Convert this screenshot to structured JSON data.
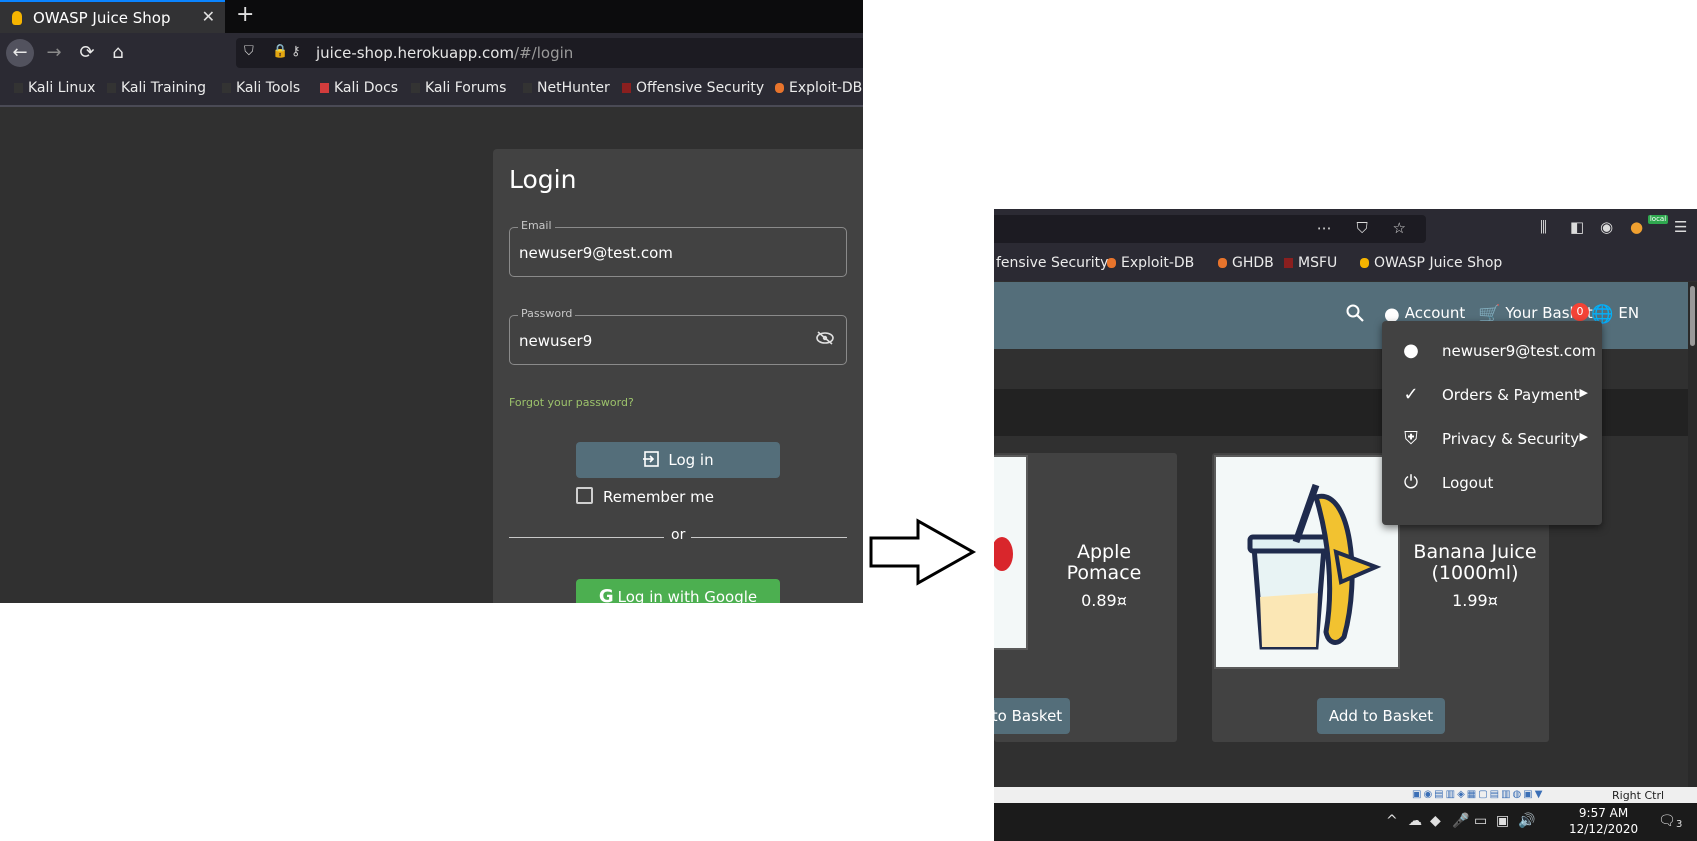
{
  "left": {
    "tab": {
      "title": "OWASP Juice Shop",
      "close": "✕",
      "new_tab": "+"
    },
    "nav": {
      "back": "←",
      "forward": "→",
      "reload": "⟳",
      "home": "⌂"
    },
    "url": {
      "host": "juice-shop.herokuapp.com",
      "path": "/#/login"
    },
    "bookmarks": [
      "Kali Linux",
      "Kali Training",
      "Kali Tools",
      "Kali Docs",
      "Kali Forums",
      "NetHunter",
      "Offensive Security",
      "Exploit-DB"
    ],
    "login": {
      "title": "Login",
      "email_label": "Email",
      "email_value": "newuser9@test.com",
      "password_label": "Password",
      "password_value": "newuser9",
      "forgot": "Forgot your password?",
      "login_button": "Log in",
      "remember": "Remember me",
      "or": "or",
      "google_button": "Log in with Google"
    }
  },
  "right": {
    "bookmarks": [
      "fensive Security",
      "Exploit-DB",
      "GHDB",
      "MSFU",
      "OWASP Juice Shop"
    ],
    "local_badge": "local",
    "header": {
      "account": "Account",
      "basket": "Your Basket",
      "basket_count": "0",
      "language": "EN"
    },
    "menu": [
      {
        "label": "newuser9@test.com",
        "icon": "account-circle-icon",
        "arrow": ""
      },
      {
        "label": "Orders & Payment",
        "icon": "check-circle-icon",
        "arrow": "▶"
      },
      {
        "label": "Privacy & Security",
        "icon": "shield-icon",
        "arrow": "▶"
      },
      {
        "label": "Logout",
        "icon": "power-icon",
        "arrow": ""
      }
    ],
    "products": [
      {
        "name": "Apple Pomace",
        "price": "0.89¤",
        "button": "to Basket"
      },
      {
        "name": "Banana Juice (1000ml)",
        "price": "1.99¤",
        "button": "Add to Basket"
      }
    ],
    "status": {
      "right_ctrl": "Right Ctrl"
    },
    "clock": {
      "time": "9:57 AM",
      "date": "12/12/2020"
    },
    "notification_count": "3"
  },
  "colors": {
    "toolbar": "#546e7a",
    "google": "#4caf50",
    "forgot": "#9cc26b",
    "badge": "#f44336"
  }
}
